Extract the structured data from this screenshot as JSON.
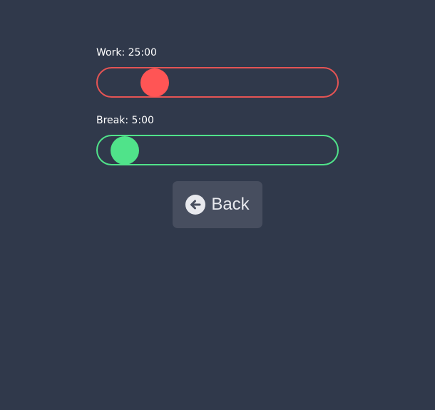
{
  "work": {
    "label": "Work: 25:00",
    "slider_value": 0.18,
    "color": "#ff5555"
  },
  "break": {
    "label": "Break: 5:00",
    "slider_value": 0.03,
    "color": "#50e38a"
  },
  "back_button": {
    "label": "Back",
    "icon": "arrow-left-circle-icon",
    "background": "#474e5f"
  },
  "colors": {
    "background": "#30394b",
    "text": "#ffffff",
    "work_border": "#e55454",
    "break_border": "#50e38a"
  }
}
